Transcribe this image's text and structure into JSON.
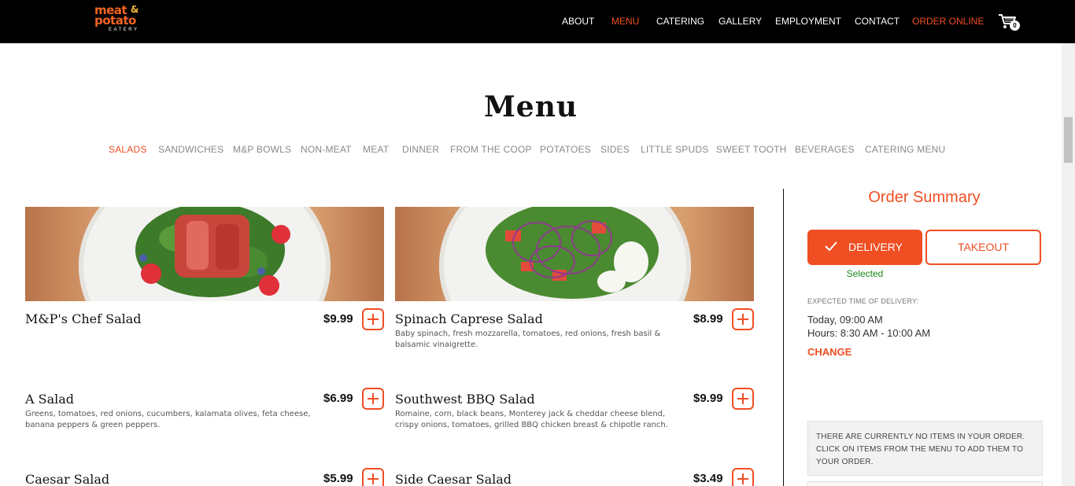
{
  "brand": {
    "line1": "meat",
    "amp": "&",
    "line2": "potato",
    "line3": "EATERY"
  },
  "nav": [
    "ABOUT",
    "MENU",
    "CATERING",
    "GALLERY",
    "EMPLOYMENT",
    "CONTACT",
    "ORDER ONLINE"
  ],
  "cart": {
    "count": "0"
  },
  "page_title": "Menu",
  "categories": [
    "SALADS",
    "SANDWICHES",
    "M&P BOWLS",
    "NON-MEAT",
    "MEAT",
    "DINNER",
    "FROM THE COOP",
    "POTATOES",
    "SIDES",
    "LITTLE SPUDS",
    "SWEET TOOTH",
    "BEVERAGES",
    "CATERING MENU"
  ],
  "dishes": [
    {
      "name": "M&P's Chef Salad",
      "price": "$9.99",
      "desc": ""
    },
    {
      "name": "Spinach Caprese Salad",
      "price": "$8.99",
      "desc": "Baby spinach, fresh mozzarella, tomatoes, red onions, fresh basil & balsamic vinaigrette."
    },
    {
      "name": "A Salad",
      "price": "$6.99",
      "desc": "Greens, tomatoes, red onions, cucumbers, kalamata olives, feta cheese, banana peppers & green peppers."
    },
    {
      "name": "Southwest BBQ Salad",
      "price": "$9.99",
      "desc": "Romaine, corn, black beans, Monterey jack & cheddar cheese blend, crispy onions, tomatoes, grilled BBQ chicken breast & chipotle ranch."
    },
    {
      "name": "Caesar Salad",
      "price": "$5.99",
      "desc": ""
    },
    {
      "name": "Side Caesar Salad",
      "price": "$3.49",
      "desc": ""
    }
  ],
  "order_summary": {
    "title": "Order Summary",
    "delivery": "DELIVERY",
    "takeout": "TAKEOUT",
    "selected": "Selected",
    "expected_label": "EXPECTED TIME OF DELIVERY:",
    "expected_time": "Today, 09:00 AM",
    "hours": "Hours: 8:30 AM - 10:00 AM",
    "change": "CHANGE",
    "empty_message": "THERE ARE CURRENTLY NO ITEMS IN YOUR ORDER. CLICK ON ITEMS FROM THE MENU TO ADD THEM TO YOUR ORDER."
  },
  "colors": {
    "accent": "#f04e23",
    "header_bg": "#000000",
    "selected_green": "#1a8a1a"
  }
}
